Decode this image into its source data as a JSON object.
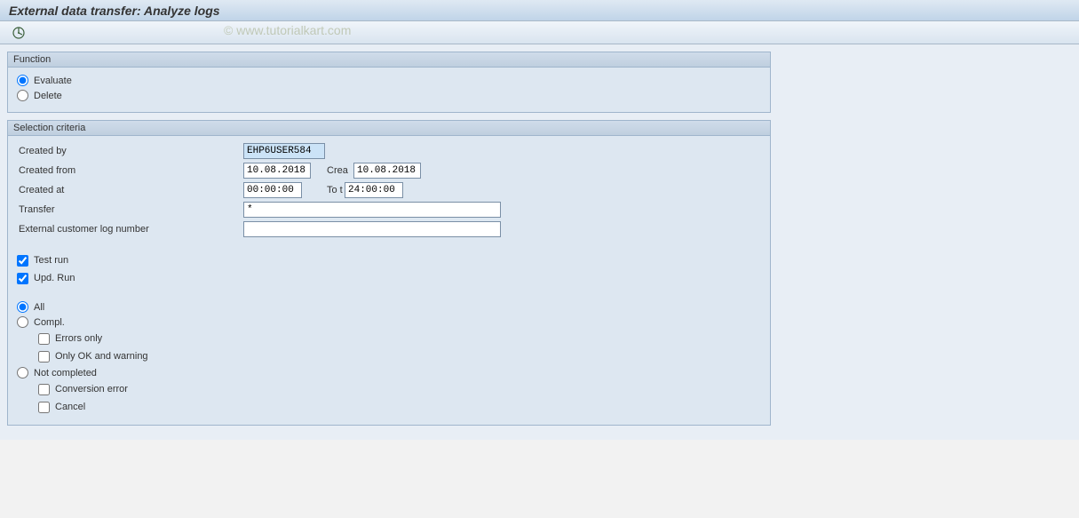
{
  "titlebar": {
    "title": "External data transfer: Analyze logs"
  },
  "watermark": "© www.tutorialkart.com",
  "function_group": {
    "title": "Function",
    "evaluate": "Evaluate",
    "delete": "Delete"
  },
  "selection_group": {
    "title": "Selection criteria",
    "created_by_label": "Created by",
    "created_by_value": "EHP6USER584",
    "created_from_label": "Created from",
    "created_from_value": "10.08.2018",
    "crea_label": "Crea",
    "crea_value": "10.08.2018",
    "created_at_label": "Created at",
    "created_at_value": "00:00:00",
    "to_t_label": "To t",
    "to_t_value": "24:00:00",
    "transfer_label": "Transfer",
    "transfer_value": "*",
    "ext_log_label": "External customer log number",
    "ext_log_value": "",
    "test_run": "Test run",
    "upd_run": "Upd. Run",
    "all": "All",
    "compl": "Compl.",
    "errors_only": "Errors only",
    "only_ok_warn": "Only OK and warning",
    "not_completed": "Not completed",
    "conversion_error": "Conversion error",
    "cancel": "Cancel"
  }
}
